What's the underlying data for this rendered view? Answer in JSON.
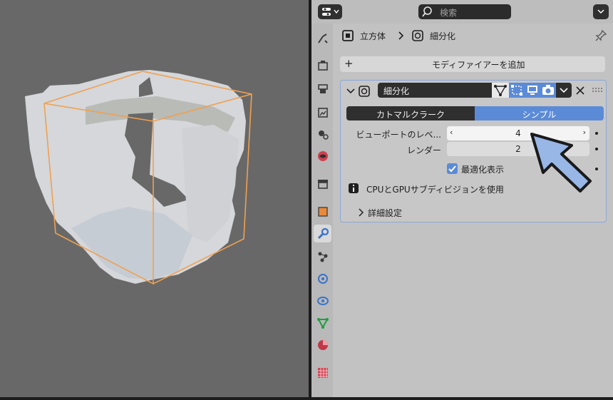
{
  "header": {
    "search_placeholder": "検索",
    "breadcrumb": {
      "object": "立方体",
      "modifier": "細分化"
    }
  },
  "add_modifier_label": "モディファイアーを追加",
  "modifier": {
    "name": "細分化",
    "mode_tabs": [
      "カトマルクラーク",
      "シンプル"
    ],
    "active_mode": "シンプル",
    "fields": [
      {
        "label": "ビューポートのレベ...",
        "value": "4"
      },
      {
        "label": "レンダー",
        "value": "2"
      }
    ],
    "optimal_display_label": "最適化表示",
    "optimal_display_checked": true,
    "info_text": "CPUとGPUサブディビジョンを使用",
    "advanced_label": "詳細設定"
  },
  "colors": {
    "accent": "#5b8bd7",
    "selection_outline": "#f0a050",
    "arrow": "#98b7e7"
  }
}
